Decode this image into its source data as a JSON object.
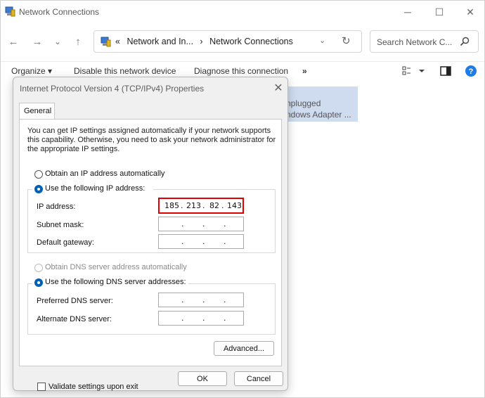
{
  "window": {
    "title": "Network Connections",
    "controls": {
      "minimize": "─",
      "maximize": "☐",
      "close": "✕"
    }
  },
  "nav": {
    "back": "←",
    "forward": "→",
    "recent": "⌄",
    "up": "↑",
    "breadcrumb": {
      "overflow": "«",
      "parent": "Network and In...",
      "sep": "›",
      "current": "Network Connections"
    },
    "dropdown": "⌄",
    "refresh": "↻",
    "search_placeholder": "Search Network C..."
  },
  "commands": {
    "organize": "Organize ▾",
    "disable": "Disable this network device",
    "diagnose": "Diagnose this connection",
    "more": "»"
  },
  "adapter": {
    "status": "nplugged",
    "device": "ndows Adapter ..."
  },
  "dialog": {
    "title": "Internet Protocol Version 4 (TCP/IPv4) Properties",
    "close": "✕",
    "tab": "General",
    "description": "You can get IP settings assigned automatically if your network supports this capability. Otherwise, you need to ask your network administrator for the appropriate IP settings.",
    "ip_auto": "Obtain an IP address automatically",
    "ip_manual": "Use the following IP address:",
    "ip_address_label": "IP address:",
    "ip_address": [
      "185",
      "213",
      "82",
      "143"
    ],
    "subnet_label": "Subnet mask:",
    "gateway_label": "Default gateway:",
    "dns_auto": "Obtain DNS server address automatically",
    "dns_manual": "Use the following DNS server addresses:",
    "preferred_dns_label": "Preferred DNS server:",
    "alternate_dns_label": "Alternate DNS server:",
    "validate": "Validate settings upon exit",
    "advanced": "Advanced...",
    "ok": "OK",
    "cancel": "Cancel",
    "dot": "."
  },
  "colors": {
    "accent": "#005fb8",
    "highlight": "#e00000",
    "adapter_bg": "#cfdcef"
  }
}
